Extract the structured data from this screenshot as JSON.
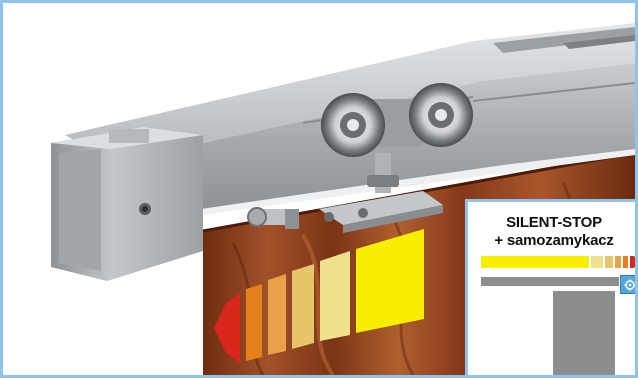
{
  "badge": {
    "line1": "SILENT-STOP",
    "line2": "+ samozamykacz"
  },
  "icons": {
    "direction_arrow": "arrow-left-icon",
    "legend_arrow": "arrow-right-icon",
    "settings": "gear-icon"
  },
  "colors": {
    "frame_border": "#8fc3ea",
    "arrow_red": "#d9261c",
    "arrow_orange": "#e5801d",
    "arrow_light_orange": "#e9a24a",
    "arrow_tan": "#e7c56a",
    "arrow_pale": "#efe28a",
    "arrow_yellow": "#f7ee00",
    "door_wood": "#8a3f1a",
    "rail_aluminium": "#b9bcbf",
    "panel_grey": "#8d8d8d",
    "settings_blue": "#5aa6dc"
  }
}
